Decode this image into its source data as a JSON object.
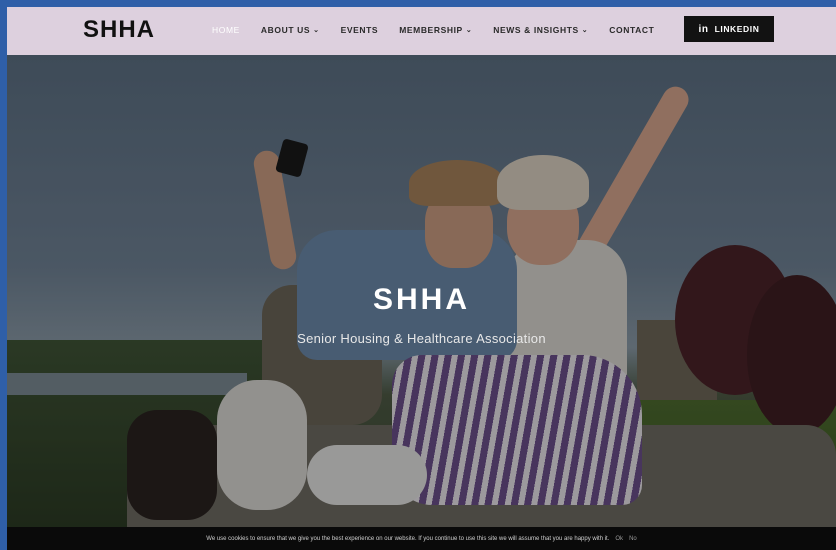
{
  "header": {
    "logo": "SHHA",
    "nav": [
      {
        "label": "HOME",
        "caret": "",
        "active": true
      },
      {
        "label": "ABOUT US",
        "caret": "⌄",
        "active": false
      },
      {
        "label": "EVENTS",
        "caret": "",
        "active": false
      },
      {
        "label": "MEMBERSHIP",
        "caret": "⌄",
        "active": false
      },
      {
        "label": "NEWS & INSIGHTS",
        "caret": "⌄",
        "active": false
      },
      {
        "label": "CONTACT",
        "caret": "",
        "active": false
      }
    ],
    "linkedin": {
      "icon_text": "in",
      "label": "LINKEDIN",
      "icon": "linkedin-icon"
    }
  },
  "hero": {
    "title": "SHHA",
    "subtitle": "Senior Housing & Healthcare Association"
  },
  "cookie": {
    "text": "We use cookies to ensure that we give you the best experience on our website. If you continue to use this site we will assume that you are happy with it.",
    "ok": "Ok",
    "no": "No"
  },
  "colors": {
    "header_bg": "#ddd0de",
    "linkedin_bg": "#121212",
    "page_border": "#2f5fa8"
  }
}
